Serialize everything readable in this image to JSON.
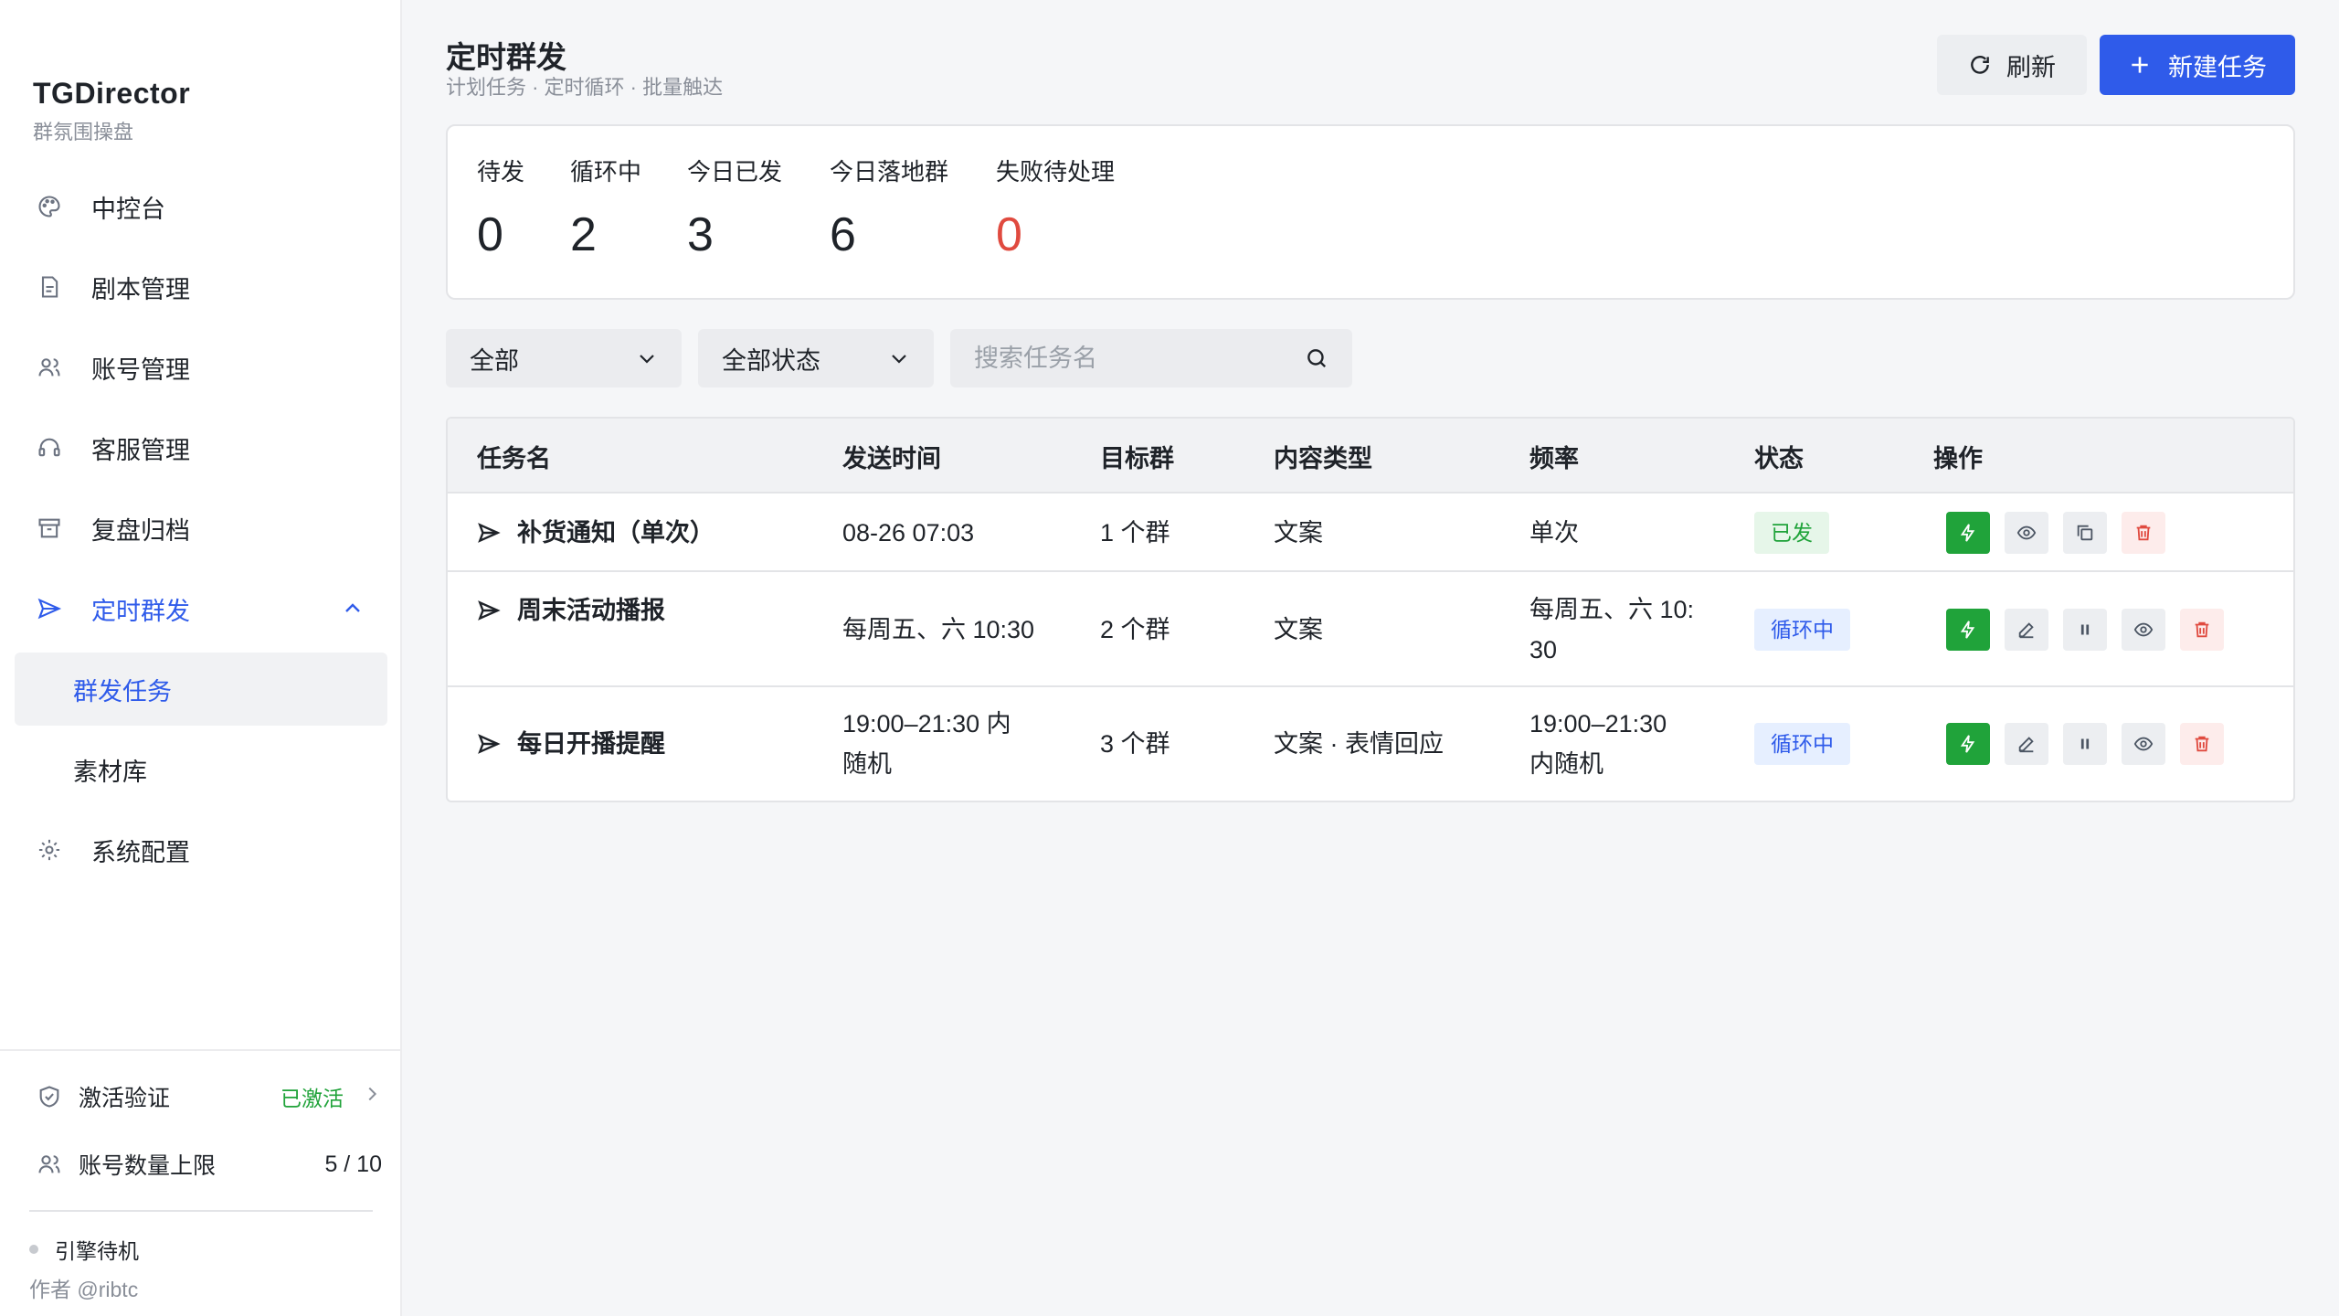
{
  "brand": {
    "title": "TGDirector",
    "subtitle": "群氛围操盘"
  },
  "nav": {
    "items": [
      {
        "label": "中控台",
        "icon": "palette-icon"
      },
      {
        "label": "剧本管理",
        "icon": "document-icon"
      },
      {
        "label": "账号管理",
        "icon": "users-icon"
      },
      {
        "label": "客服管理",
        "icon": "headset-icon"
      },
      {
        "label": "复盘归档",
        "icon": "archive-icon"
      },
      {
        "label": "定时群发",
        "icon": "send-icon",
        "active": true
      },
      {
        "label": "系统配置",
        "icon": "gear-icon"
      }
    ],
    "sub_items": [
      {
        "label": "群发任务",
        "active": true
      },
      {
        "label": "素材库"
      }
    ]
  },
  "sidebar_bottom": {
    "activation_label": "激活验证",
    "activation_status": "已激活",
    "account_limit_label": "账号数量上限",
    "account_limit_value": "5 / 10",
    "engine_status": "引擎待机",
    "author": "作者 @ribtc"
  },
  "header": {
    "title": "定时群发",
    "subtitle": "计划任务 · 定时循环 · 批量触达",
    "refresh_label": "刷新",
    "new_task_label": "新建任务"
  },
  "stats": [
    {
      "label": "待发",
      "value": "0"
    },
    {
      "label": "循环中",
      "value": "2"
    },
    {
      "label": "今日已发",
      "value": "3"
    },
    {
      "label": "今日落地群",
      "value": "6"
    },
    {
      "label": "失败待处理",
      "value": "0"
    }
  ],
  "filters": {
    "type_select": "全部",
    "status_select": "全部状态",
    "search_placeholder": "搜索任务名"
  },
  "table": {
    "columns": [
      "任务名",
      "发送时间",
      "目标群",
      "内容类型",
      "频率",
      "状态",
      "操作"
    ],
    "rows": [
      {
        "name": "补货通知（单次）",
        "send_time": "08-26 07:03",
        "target": "1 个群",
        "content_type": "文案",
        "frequency": "单次",
        "status": "已发",
        "status_kind": "sent"
      },
      {
        "name": "周末活动播报",
        "send_time": "每周五、六 10:30",
        "target": "2 个群",
        "content_type": "文案",
        "frequency": "每周五、六 10:\n30",
        "status": "循环中",
        "status_kind": "loop"
      },
      {
        "name": "每日开播提醒",
        "send_time": "19:00–21:30 内\n随机",
        "target": "3 个群",
        "content_type": "文案 · 表情回应",
        "frequency": "19:00–21:30\n内随机",
        "status": "循环中",
        "status_kind": "loop"
      }
    ]
  },
  "colors": {
    "accent": "#2f5bea",
    "success": "#20a33a",
    "danger": "#e04a3f"
  }
}
